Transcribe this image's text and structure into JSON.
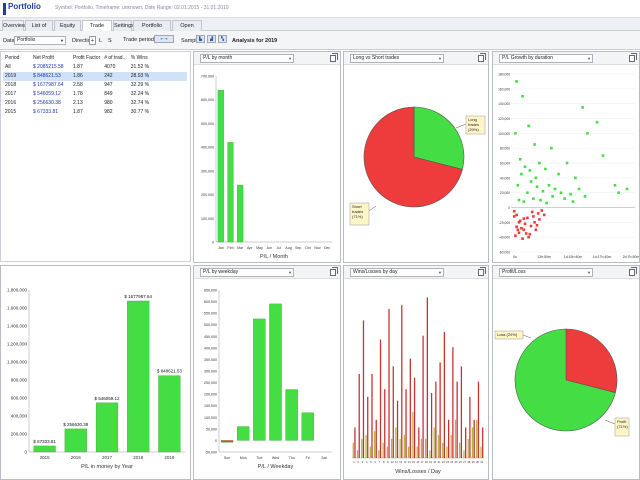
{
  "window": {
    "title": "Portfolio",
    "subtitle": "Symbol: Portfolio, Timeframe: unknown, Date Range: 02.01.2015 - 31.01.2019"
  },
  "tabs": [
    {
      "label": "Overview",
      "active": false
    },
    {
      "label": "List of trades",
      "active": false
    },
    {
      "label": "Equity chart",
      "active": false
    },
    {
      "label": "Trade analysis",
      "active": true
    },
    {
      "label": "Settings",
      "active": false
    },
    {
      "label": "Portfolio correlation",
      "active": false
    },
    {
      "label": "Open balances",
      "active": false
    }
  ],
  "toolbar": {
    "data_label": "Data",
    "data_value": "Portfolio",
    "direction_label": "Direction",
    "dir_options": [
      "+",
      "L",
      "S"
    ],
    "trade_period_label": "Trade period by",
    "sample_label": "Sample",
    "analysis_text": "Analysis for 2019"
  },
  "summary": {
    "headers": [
      "Period",
      "Net Profit",
      "Profit Factor",
      "# of trad...",
      "% Wins"
    ],
    "rows": [
      {
        "period": "All",
        "net_profit": "$ 2085215.58",
        "pf": "1.87",
        "trades": "4070",
        "wins": "31.52 %",
        "selected": false
      },
      {
        "period": "2019",
        "net_profit": "$ 848621.53",
        "pf": "1.86",
        "trades": "242",
        "wins": "28.93 %",
        "selected": true
      },
      {
        "period": "2018",
        "net_profit": "$ 1677987.64",
        "pf": "2.58",
        "trades": "947",
        "wins": "32.29 %",
        "selected": false
      },
      {
        "period": "2017",
        "net_profit": "$ 546059.12",
        "pf": "1.78",
        "trades": "849",
        "wins": "32.24 %",
        "selected": false
      },
      {
        "period": "2016",
        "net_profit": "$ 256630.38",
        "pf": "2.13",
        "trades": "980",
        "wins": "32.74 %",
        "selected": false
      },
      {
        "period": "2015",
        "net_profit": "$ 67333.81",
        "pf": "1.87",
        "trades": "982",
        "wins": "30.77 %",
        "selected": false
      }
    ]
  },
  "panels": {
    "pl_month_select": "P/L by month",
    "long_short_select": "Long vs Short trades",
    "pl_growth_select": "P/L Growth by duration",
    "pl_weekday_select": "P/L by weekday",
    "wins_losses_select": "Wins/Losses by day",
    "profit_loss_select": "Profit/Loss"
  },
  "chart_data": [
    {
      "type": "bar",
      "id": "pl_month",
      "xlabel": "P/L / Month",
      "categories": [
        "Jan",
        "Feb",
        "Mar",
        "Apr",
        "May",
        "Jun",
        "Jul",
        "Aug",
        "Sep",
        "Oct",
        "Nov",
        "Dec"
      ],
      "values": [
        640000,
        420000,
        240000,
        0,
        0,
        0,
        0,
        0,
        0,
        0,
        0,
        0
      ],
      "ylim": [
        0,
        700000
      ],
      "yticks": [
        "700,000",
        "600,000",
        "500,000",
        "400,000",
        "300,000",
        "200,000",
        "100,000",
        "0"
      ],
      "color": "#44dd44"
    },
    {
      "type": "pie",
      "id": "long_short",
      "slices": [
        {
          "label": "Long trades (29%)",
          "value": 29,
          "color": "#44dd44"
        },
        {
          "label": "Short trades (71%)",
          "value": 71,
          "color": "#ee3b3b"
        }
      ]
    },
    {
      "type": "scatter",
      "id": "pl_growth",
      "xticks": [
        "0s",
        "13h:50m",
        "1d:15h:40m",
        "1d:17h:40m",
        "2d:7h:50m"
      ],
      "yticks": [
        "180,000",
        "160,000",
        "140,000",
        "120,000",
        "100,000",
        "80,000",
        "60,000",
        "40,000",
        "20,000",
        "0",
        "-20,000",
        "-40,000",
        "-60,000"
      ],
      "ylim": [
        -60000,
        180000
      ],
      "series": [
        {
          "color": "#44dd44",
          "points": [
            [
              0.03,
              170000
            ],
            [
              0.08,
              150000
            ],
            [
              0.02,
              100000
            ],
            [
              0.13,
              110000
            ],
            [
              0.06,
              65000
            ],
            [
              0.1,
              55000
            ],
            [
              0.18,
              85000
            ],
            [
              0.22,
              60000
            ],
            [
              0.27,
              52000
            ],
            [
              0.32,
              80000
            ],
            [
              0.38,
              45000
            ],
            [
              0.45,
              60000
            ],
            [
              0.52,
              40000
            ],
            [
              0.58,
              135000
            ],
            [
              0.62,
              100000
            ],
            [
              0.7,
              115000
            ],
            [
              0.75,
              70000
            ],
            [
              0.85,
              30000
            ],
            [
              0.88,
              20000
            ],
            [
              0.95,
              25000
            ],
            [
              0.15,
              35000
            ],
            [
              0.2,
              28000
            ],
            [
              0.25,
              22000
            ],
            [
              0.3,
              30000
            ],
            [
              0.35,
              25000
            ],
            [
              0.4,
              20000
            ],
            [
              0.48,
              18000
            ],
            [
              0.55,
              25000
            ],
            [
              0.6,
              15000
            ],
            [
              0.12,
              20000
            ],
            [
              0.05,
              10000
            ],
            [
              0.09,
              8000
            ],
            [
              0.17,
              12000
            ],
            [
              0.23,
              10000
            ],
            [
              0.28,
              6000
            ],
            [
              0.33,
              15000
            ],
            [
              0.43,
              12000
            ],
            [
              0.5,
              8000
            ],
            [
              0.04,
              30000
            ],
            [
              0.07,
              45000
            ],
            [
              0.14,
              50000
            ],
            [
              0.19,
              40000
            ]
          ]
        },
        {
          "color": "#ee3b3b",
          "points": [
            [
              0.01,
              -5000
            ],
            [
              0.03,
              -10000
            ],
            [
              0.05,
              -20000
            ],
            [
              0.07,
              -28000
            ],
            [
              0.09,
              -15000
            ],
            [
              0.11,
              -35000
            ],
            [
              0.13,
              -40000
            ],
            [
              0.15,
              -25000
            ],
            [
              0.17,
              -12000
            ],
            [
              0.19,
              -30000
            ],
            [
              0.21,
              -8000
            ],
            [
              0.02,
              -38000
            ],
            [
              0.04,
              -30000
            ],
            [
              0.06,
              -18000
            ],
            [
              0.08,
              -42000
            ],
            [
              0.1,
              -22000
            ],
            [
              0.12,
              -14000
            ],
            [
              0.14,
              -36000
            ],
            [
              0.16,
              -6000
            ],
            [
              0.18,
              -20000
            ],
            [
              0.2,
              -24000
            ],
            [
              0.03,
              -26000
            ],
            [
              0.22,
              -16000
            ],
            [
              0.24,
              -4000
            ],
            [
              0.01,
              -12000
            ],
            [
              0.26,
              -10000
            ],
            [
              0.05,
              -34000
            ],
            [
              0.09,
              -30000
            ]
          ]
        }
      ]
    },
    {
      "type": "bar",
      "id": "pl_year",
      "xlabel": "P/L in money by Year",
      "categories": [
        "2015",
        "2016",
        "2017",
        "2018",
        "2019"
      ],
      "values": [
        67333.81,
        256630.38,
        546059.12,
        1677987.64,
        848621.53
      ],
      "labels": [
        "$ 67333.81",
        "$ 256630.38",
        "$ 546059.12",
        "$ 1677987.64",
        "$ 848621.53"
      ],
      "ylim": [
        0,
        1800000
      ],
      "yticks": [
        "1,800,000",
        "1,600,000",
        "1,400,000",
        "1,200,000",
        "1,000,000",
        "800,000",
        "600,000",
        "400,000",
        "200,000",
        "0"
      ],
      "color": "#44dd44"
    },
    {
      "type": "bar",
      "id": "pl_weekday",
      "xlabel": "P/L / Weekday",
      "categories": [
        "Sun",
        "Mon",
        "Tue",
        "Wed",
        "Thu",
        "Fri",
        "Sat"
      ],
      "values": [
        -8000,
        60000,
        525000,
        590000,
        220000,
        120000,
        0
      ],
      "ylim": [
        -50000,
        650000
      ],
      "yticks": [
        "650,000",
        "600,000",
        "550,000",
        "500,000",
        "450,000",
        "400,000",
        "350,000",
        "300,000",
        "250,000",
        "200,000",
        "150,000",
        "100,000",
        "50,000",
        "0",
        "-50,000"
      ],
      "color": "#44dd44",
      "neg_color": "#ee3b3b"
    },
    {
      "type": "bar",
      "id": "wins_losses",
      "xlabel": "Wins/Losses / Day",
      "categories": [
        "1",
        "2",
        "3",
        "4",
        "5",
        "6",
        "7",
        "8",
        "9",
        "10",
        "11",
        "12",
        "13",
        "14",
        "15",
        "16",
        "17",
        "18",
        "19",
        "20",
        "21",
        "22",
        "23",
        "24",
        "25",
        "26",
        "27",
        "28",
        "29",
        "30",
        "31"
      ],
      "series": [
        {
          "name": "wins",
          "color": "#b8b24a",
          "values": [
            4,
            2,
            5,
            6,
            3,
            7,
            2,
            4,
            3,
            5,
            8,
            5,
            6,
            3,
            12,
            3,
            5,
            5,
            2,
            8,
            6,
            4,
            3,
            6,
            10,
            4,
            2,
            5,
            8,
            10,
            3
          ]
        },
        {
          "name": "losses",
          "color": "#c83030",
          "values": [
            8,
            22,
            36,
            16,
            22,
            10,
            31,
            18,
            39,
            24,
            15,
            40,
            18,
            26,
            21,
            8,
            32,
            42,
            17,
            20,
            25,
            33,
            10,
            29,
            20,
            24,
            8,
            16,
            10,
            20,
            8
          ]
        }
      ],
      "ylim": [
        0,
        45
      ]
    },
    {
      "type": "pie",
      "id": "profit_loss",
      "slices": [
        {
          "label": "Loss (29%)",
          "value": 29,
          "color": "#ee3b3b"
        },
        {
          "label": "Profit (71%)",
          "value": 71,
          "color": "#44dd44"
        }
      ]
    }
  ]
}
